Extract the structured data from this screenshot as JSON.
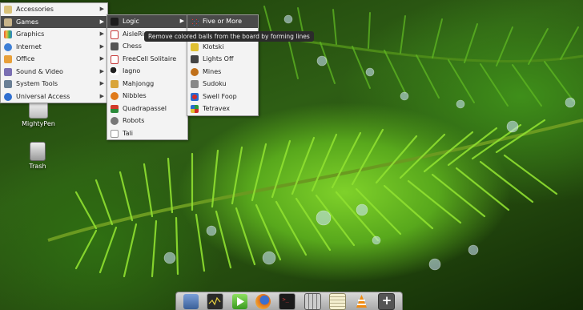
{
  "desktop": {
    "icons": [
      {
        "label": "MightyPen",
        "icon": "pen-app-icon"
      },
      {
        "label": "Trash",
        "icon": "trash-icon"
      }
    ]
  },
  "main_menu": {
    "items": [
      {
        "label": "Accessories",
        "icon": "accessories-icon",
        "color": "#d9c27a"
      },
      {
        "label": "Games",
        "icon": "games-icon",
        "color": "#c8b48a"
      },
      {
        "label": "Graphics",
        "icon": "graphics-icon",
        "color": "#e2553a"
      },
      {
        "label": "Internet",
        "icon": "internet-icon",
        "color": "#3d7fd6"
      },
      {
        "label": "Office",
        "icon": "office-icon",
        "color": "#e8a03a"
      },
      {
        "label": "Sound & Video",
        "icon": "sound-video-icon",
        "color": "#7a6fb2"
      },
      {
        "label": "System Tools",
        "icon": "system-tools-icon",
        "color": "#6a7f95"
      },
      {
        "label": "Universal Access",
        "icon": "universal-access-icon",
        "color": "#2f6fd0"
      }
    ]
  },
  "games_menu": {
    "items": [
      {
        "label": "Logic",
        "icon": "logic-icon",
        "color": "#1d1d1d"
      },
      {
        "label": "AisleRio",
        "icon": "cards-icon",
        "color": "#c83a3a"
      },
      {
        "label": "Chess",
        "icon": "chess-icon",
        "color": "#555555"
      },
      {
        "label": "FreeCell Solitaire",
        "icon": "freecell-icon",
        "color": "#c83a3a"
      },
      {
        "label": "Iagno",
        "icon": "iagno-icon",
        "color": "#222222"
      },
      {
        "label": "Mahjongg",
        "icon": "mahjongg-icon",
        "color": "#d9a53a"
      },
      {
        "label": "Nibbles",
        "icon": "nibbles-icon",
        "color": "#e07a1a"
      },
      {
        "label": "Quadrapassel",
        "icon": "quadrapassel-icon",
        "color": "#d23a2a"
      },
      {
        "label": "Robots",
        "icon": "robots-icon",
        "color": "#777777"
      },
      {
        "label": "Tali",
        "icon": "tali-icon",
        "color": "#999999"
      }
    ]
  },
  "logic_menu": {
    "items": [
      {
        "label": "Five or More",
        "icon": "five-or-more-icon",
        "color": "#3a6fd0"
      },
      {
        "label": "Klotski",
        "icon": "klotski-icon",
        "color": "#e0c030"
      },
      {
        "label": "Lights Off",
        "icon": "lights-off-icon",
        "color": "#444444"
      },
      {
        "label": "Mines",
        "icon": "mines-icon",
        "color": "#c0701a"
      },
      {
        "label": "Sudoku",
        "icon": "sudoku-icon",
        "color": "#888888"
      },
      {
        "label": "Swell Foop",
        "icon": "swell-foop-icon",
        "color": "#d02a2a"
      },
      {
        "label": "Tetravex",
        "icon": "tetravex-icon",
        "color": "#2a9a3a"
      }
    ]
  },
  "tooltip": "Remove colored balls from the board by forming lines",
  "dock": {
    "items": [
      {
        "icon": "file-manager-icon",
        "color": "#5a7fb8"
      },
      {
        "icon": "system-monitor-icon",
        "color": "#2a2a2a"
      },
      {
        "icon": "media-player-icon",
        "color": "#5cb83a"
      },
      {
        "icon": "firefox-icon",
        "color": "#e0701a"
      },
      {
        "icon": "terminal-icon",
        "color": "#222222"
      },
      {
        "icon": "calculator-icon",
        "color": "#8a8a8a"
      },
      {
        "icon": "text-editor-icon",
        "color": "#e8e0b0"
      },
      {
        "icon": "vlc-icon",
        "color": "#f08a10"
      },
      {
        "icon": "add-launcher-icon",
        "color": "#555555"
      }
    ]
  },
  "colors": {
    "menu_bg": "#f3f3f3",
    "menu_active": "#4a4a4a",
    "tooltip_bg": "#2b2b2b"
  }
}
